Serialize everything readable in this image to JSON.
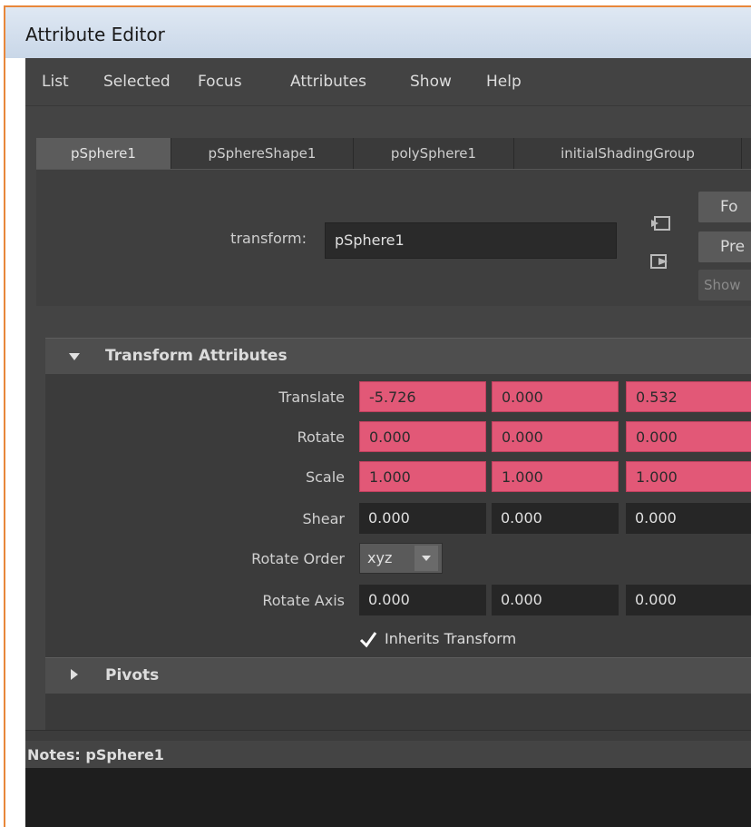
{
  "window": {
    "title": "Attribute Editor"
  },
  "menu": [
    "List",
    "Selected",
    "Focus",
    "Attributes",
    "Show",
    "Help"
  ],
  "tabs": [
    {
      "label": "pSphere1",
      "active": true
    },
    {
      "label": "pSphereShape1",
      "active": false
    },
    {
      "label": "polySphere1",
      "active": false
    },
    {
      "label": "initialShadingGroup",
      "active": false
    }
  ],
  "node": {
    "type_label": "transform:",
    "name_value": "pSphere1",
    "buttons": {
      "focus": "Fo",
      "presets": "Pre",
      "show": "Show"
    }
  },
  "transform_section": {
    "title": "Transform Attributes",
    "rows": [
      {
        "label": "Translate",
        "values": [
          "-5.726",
          "0.000",
          "0.532"
        ],
        "keyed": true
      },
      {
        "label": "Rotate",
        "values": [
          "0.000",
          "0.000",
          "0.000"
        ],
        "keyed": true
      },
      {
        "label": "Scale",
        "values": [
          "1.000",
          "1.000",
          "1.000"
        ],
        "keyed": true
      },
      {
        "label": "Shear",
        "values": [
          "0.000",
          "0.000",
          "0.000"
        ],
        "keyed": false
      }
    ],
    "rotate_order": {
      "label": "Rotate Order",
      "value": "xyz"
    },
    "rotate_axis": {
      "label": "Rotate Axis",
      "values": [
        "0.000",
        "0.000",
        "0.000"
      ]
    },
    "inherits": {
      "label": "Inherits Transform",
      "checked": true
    }
  },
  "pivots_section": {
    "title": "Pivots"
  },
  "notes": {
    "label": "Notes: pSphere1",
    "value": ""
  },
  "colors": {
    "keyed_field": "#e25877",
    "window_border": "#e8873a",
    "panel_bg": "#444444"
  }
}
